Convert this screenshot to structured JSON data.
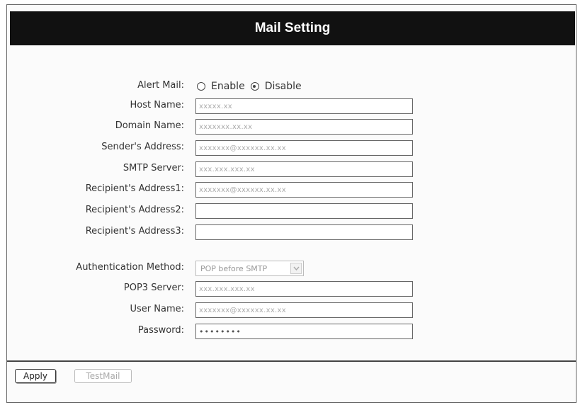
{
  "page": {
    "title": "Mail Setting"
  },
  "alert_mail": {
    "label": "Alert Mail:",
    "options": [
      {
        "label": "Enable",
        "checked": false
      },
      {
        "label": "Disable",
        "checked": true
      }
    ]
  },
  "fields": {
    "host_name": {
      "label": "Host Name:",
      "value": "xxxxx.xx"
    },
    "domain_name": {
      "label": "Domain Name:",
      "value": "xxxxxxx.xx.xx"
    },
    "sender_address": {
      "label": "Sender's Address:",
      "value": "xxxxxxx@xxxxxx.xx.xx"
    },
    "smtp_server": {
      "label": "SMTP Server:",
      "value": "xxx.xxx.xxx.xx"
    },
    "recipient_address1": {
      "label": "Recipient's Address1:",
      "value": "xxxxxxx@xxxxxx.xx.xx"
    },
    "recipient_address2": {
      "label": "Recipient's Address2:",
      "value": ""
    },
    "recipient_address3": {
      "label": "Recipient's Address3:",
      "value": ""
    },
    "authentication_method": {
      "label": "Authentication Method:",
      "value": "POP before SMTP"
    },
    "pop3_server": {
      "label": "POP3 Server:",
      "value": "xxx.xxx.xxx.xx"
    },
    "user_name": {
      "label": "User Name:",
      "value": "xxxxxxx@xxxxxx.xx.xx"
    },
    "password": {
      "label": "Password:",
      "value": "••••••••"
    }
  },
  "buttons": {
    "apply": "Apply",
    "test_mail": "TestMail"
  },
  "icons": {
    "select_arrow": "chevron-down-icon"
  }
}
